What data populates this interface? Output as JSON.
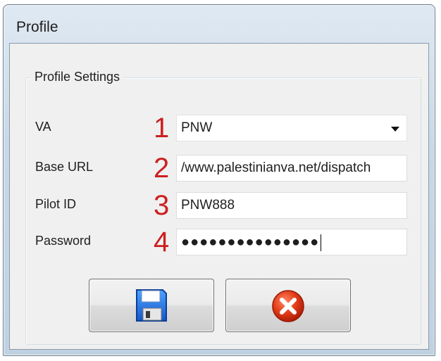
{
  "window": {
    "title": "Profile"
  },
  "group": {
    "title": "Profile Settings"
  },
  "fields": [
    {
      "label": "VA",
      "number": "1",
      "value": "PNW",
      "type": "combo"
    },
    {
      "label": "Base URL",
      "number": "2",
      "value": "/www.palestinianva.net/dispatch",
      "type": "text"
    },
    {
      "label": "Pilot ID",
      "number": "3",
      "value": "PNW888",
      "type": "text"
    },
    {
      "label": "Password",
      "number": "4",
      "value": "●●●●●●●●●●●●●●●",
      "type": "password"
    }
  ],
  "buttons": {
    "save_icon": "floppy-disk-icon",
    "cancel_icon": "red-x-icon"
  },
  "colors": {
    "number_annotation": "#cc1f1f",
    "client_background": "#f0f0f0"
  }
}
